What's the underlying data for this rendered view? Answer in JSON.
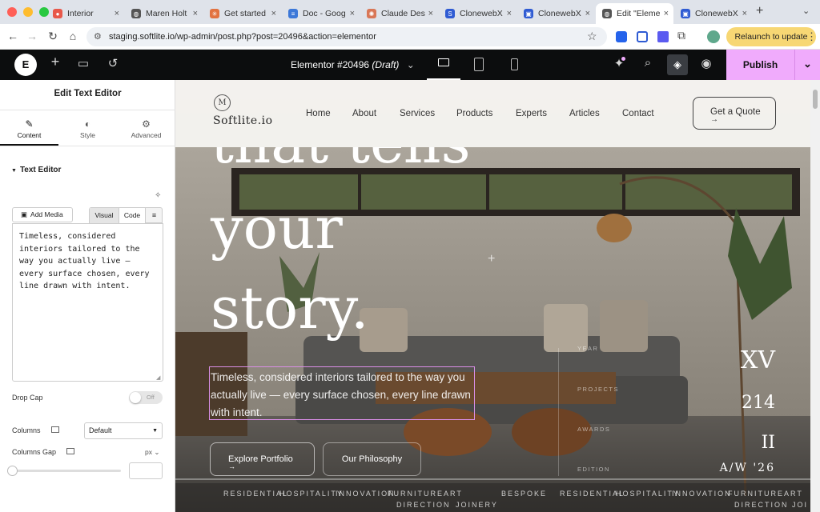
{
  "browser": {
    "tabs": [
      {
        "label": "Interior",
        "icon": "pin-icon",
        "color": "#e8584a"
      },
      {
        "label": "Maren Holt",
        "icon": "globe-icon",
        "color": "#555555"
      },
      {
        "label": "Get started",
        "icon": "asterisk-icon",
        "color": "#e27240"
      },
      {
        "label": "Doc - Goog",
        "icon": "doc-icon",
        "color": "#3c78d8"
      },
      {
        "label": "Claude Des",
        "icon": "claude-icon",
        "color": "#d97757"
      },
      {
        "label": "ClonewebX",
        "icon": "s-icon",
        "color": "#2f5bd3"
      },
      {
        "label": "ClonewebX",
        "icon": "clone-icon",
        "color": "#2f5bd3"
      },
      {
        "label": "Edit \"Eleme",
        "icon": "globe-icon",
        "color": "#555555"
      },
      {
        "label": "ClonewebX",
        "icon": "clone-icon",
        "color": "#2f5bd3"
      }
    ],
    "url": "staging.softlite.io/wp-admin/post.php?post=20496&action=elementor",
    "relaunch": "Relaunch to update"
  },
  "editor": {
    "doc_title": "Elementor #20496",
    "doc_status": "(Draft)",
    "publish": "Publish"
  },
  "panel": {
    "title": "Edit Text Editor",
    "tabs": [
      "Content",
      "Style",
      "Advanced"
    ],
    "section": "Text Editor",
    "add_media": "Add Media",
    "mode_visual": "Visual",
    "mode_code": "Code",
    "text": "Timeless, considered interiors tailored to the way you actually live — every surface chosen, every line drawn with intent.",
    "drop_cap_label": "Drop Cap",
    "drop_cap_value": "Off",
    "columns_label": "Columns",
    "columns_value": "Default",
    "gap_label": "Columns Gap",
    "gap_unit": "px"
  },
  "site": {
    "logo_mark": "M",
    "logo_text": "Softlite.io",
    "nav": [
      "Home",
      "About",
      "Services",
      "Products",
      "Experts",
      "Articles",
      "Contact"
    ],
    "cta": "Get a Quote",
    "hero_lines": [
      "that tells",
      "your",
      "story."
    ],
    "hero_text": "Timeless, considered interiors tailored to the way you actually live — every surface chosen, every line drawn with intent.",
    "btn_primary": "Explore Portfolio",
    "btn_secondary": "Our Philosophy",
    "stats": [
      {
        "label": "YEAR",
        "value": "XV"
      },
      {
        "label": "PROJECTS",
        "value": "214"
      },
      {
        "label": "AWARDS",
        "value": "II"
      },
      {
        "label": "EDITION",
        "value": "A/W '26"
      }
    ],
    "ticker_top": [
      "RESIDENTIAL",
      "HOSPITALITY",
      "INNOVATION",
      "FURNITURE",
      "ART",
      "BESPOKE",
      "RESIDENTIAL",
      "HOSPITALITY",
      "INNOVATION",
      "FURNITURE",
      "ART"
    ],
    "ticker_bottom": [
      "DIRECTION",
      "JOINERY",
      "DIRECTION",
      "JOI"
    ]
  },
  "colors": {
    "accent": "#f0abfc",
    "editor_bar": "#0c0d0e",
    "selection": "#d98ee6"
  }
}
